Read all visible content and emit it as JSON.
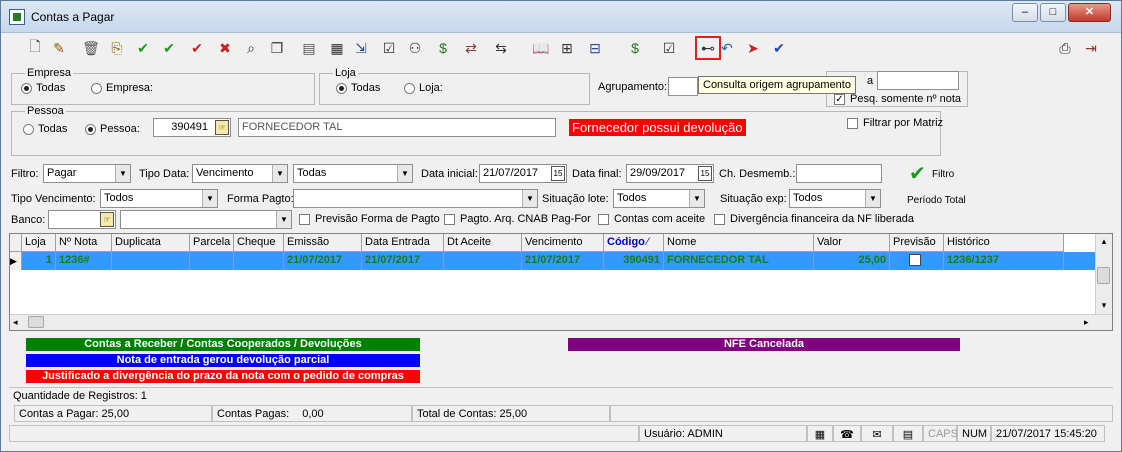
{
  "window": {
    "title": "Contas a Pagar"
  },
  "titlebar_buttons": {
    "minimize": "–",
    "maximize": "□",
    "close": "✕"
  },
  "toolbar": {
    "tooltip": "Consulta origem agrupamento",
    "icons": [
      "new-document-icon",
      "edit-icon",
      "delete-icon",
      "copy-icon",
      "confirm-icon",
      "confirm-all-icon",
      "confirm-red-icon",
      "cancel-icon",
      "search-icon",
      "duplicate-icon",
      "print-grid-icon",
      "calculator-icon",
      "export-icon",
      "checklist-icon",
      "users-icon",
      "money-icon",
      "transfer-icon",
      "arrows-icon",
      "book-icon",
      "tree-icon",
      "columns-icon",
      "money-green-icon",
      "checkbox-list-icon",
      "binoculars-icon",
      "undo-icon",
      "send-icon",
      "checkmark-blue-icon",
      "printer-icon",
      "exit-icon"
    ],
    "glyphs": [
      "🗋",
      "✎",
      "🗑",
      "⎘",
      "✔",
      "✔",
      "✔",
      "✖",
      "⌕",
      "❐",
      "▤",
      "▦",
      "⇲",
      "☑",
      "⚇",
      "$",
      "⇄",
      "⇆",
      "📖",
      "⊞",
      "⊟",
      "$",
      "☑",
      "⊷",
      "↶",
      "➤",
      "✔",
      "⎙",
      "⇥"
    ],
    "colors": [
      "#333",
      "#8a5a00",
      "#555",
      "#8a6a00",
      "#1a9a1a",
      "#1a9a1a",
      "#cc2020",
      "#cc2020",
      "#333",
      "#333",
      "#555",
      "#333",
      "#2a4a8a",
      "#333",
      "#333",
      "#1a7a1a",
      "#8a3a3a",
      "#333",
      "#555",
      "#333",
      "#2a4a8a",
      "#1a7a1a",
      "#333",
      "#333",
      "#2a5aaa",
      "#cc2020",
      "#2040cc",
      "#333",
      "#8a3a3a"
    ]
  },
  "empresa": {
    "legend": "Empresa",
    "opt_all": "Todas",
    "opt_one": "Empresa:"
  },
  "loja": {
    "legend": "Loja",
    "opt_all": "Todas",
    "opt_one": "Loja:"
  },
  "agrupamento": {
    "label": "Agrupamento:",
    "value": "",
    "pesq_label": "Pesq. somente nº nota",
    "pesq_checked": true,
    "side_letter": "a"
  },
  "pessoa": {
    "legend": "Pessoa",
    "opt_all": "Todas",
    "opt_one": "Pessoa:",
    "code": "390491",
    "name": "FORNECEDOR TAL",
    "warning": "Fornecedor possui devolução"
  },
  "filtrar_matriz": {
    "label": "Filtrar por Matriz"
  },
  "filters": {
    "filtro_label": "Filtro:",
    "filtro_value": "Pagar",
    "tipo_data_label": "Tipo Data:",
    "tipo_data_value": "Vencimento",
    "todas_value": "Todas",
    "data_inicial_label": "Data inicial:",
    "data_inicial": "21/07/2017",
    "data_final_label": "Data final:",
    "data_final": "29/09/2017",
    "ch_desmemb_label": "Ch. Desmemb.:",
    "ch_desmemb": "",
    "filtro_button": "Filtro",
    "periodo_total": "Período Total",
    "tipo_venc_label": "Tipo Vencimento:",
    "tipo_venc_value": "Todos",
    "forma_pagto_label": "Forma Pagto:",
    "forma_pagto_value": "",
    "situacao_lote_label": "Situação lote:",
    "situacao_lote_value": "Todos",
    "situacao_exp_label": "Situação exp:",
    "situacao_exp_value": "Todos",
    "banco_label": "Banco:",
    "previsao_forma": "Previsão Forma de Pagto",
    "pagto_arq": "Pagto. Arq. CNAB Pag-For",
    "contas_aceite": "Contas com aceite",
    "divergencia": "Divergência financeira da NF liberada"
  },
  "grid": {
    "columns": [
      "Loja",
      "Nº Nota",
      "Duplicata",
      "Parcela",
      "Cheque",
      "Emissão",
      "Data Entrada",
      "Dt Aceite",
      "Vencimento",
      "Código",
      "Nome",
      "Valor",
      "Previsão",
      "Histórico"
    ],
    "sort_column": "Código",
    "sort_indicator": "⁄",
    "row_marker": "▶",
    "rows": [
      {
        "loja": "1",
        "nota": "1236#",
        "duplicata": "",
        "parcela": "",
        "cheque": "",
        "emissao": "21/07/2017",
        "entrada": "21/07/2017",
        "aceite": "",
        "vencimento": "21/07/2017",
        "codigo": "390491",
        "nome": "FORNECEDOR TAL",
        "valor": "25,00",
        "previsao": false,
        "historico": "1236/1237"
      }
    ],
    "selected_row_color": "#3399ff",
    "scroll_left": "◂",
    "scroll_right": "▸",
    "scroll_up": "▴",
    "scroll_down": "▾"
  },
  "legend_bars": {
    "green": "Contas a Receber / Contas Cooperados / Devoluções",
    "blue": "Nota de entrada gerou devolução parcial",
    "red": "Justificado a divergência do prazo da nota com o pedido de compras",
    "purple": "NFE Cancelada"
  },
  "colors": {
    "green": "#008000",
    "blue": "#0000ff",
    "red": "#ff0000",
    "purple": "#800080"
  },
  "footer": {
    "quantidade": "Quantidade de Registros: 1",
    "contas_pagar": "Contas a Pagar:  25,00",
    "contas_pagas": "Contas Pagas:",
    "contas_pagas_value": "0,00",
    "total_contas": "Total de Contas: 25,00",
    "usuario": "Usuário: ADMIN",
    "caps": "CAPS",
    "num": "NUM",
    "datetime": "21/07/2017 15:45:20"
  }
}
